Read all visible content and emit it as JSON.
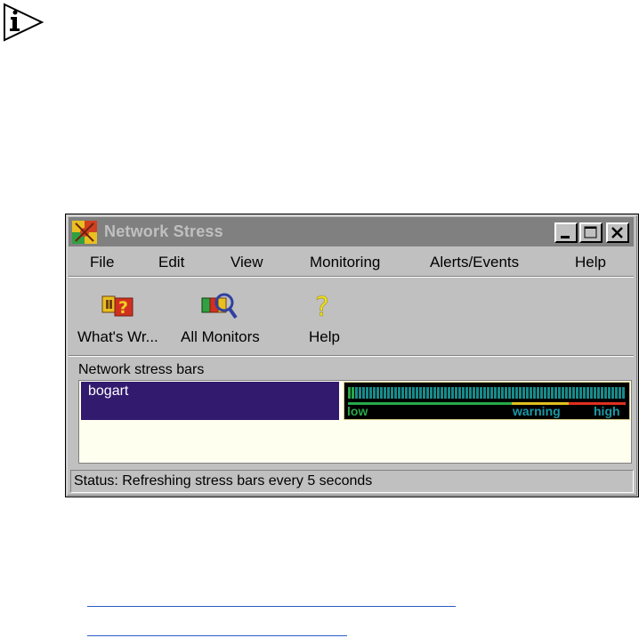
{
  "window": {
    "title": "Network Stress",
    "controls": [
      "minimize",
      "maximize",
      "close"
    ]
  },
  "menu": [
    "File",
    "Edit",
    "View",
    "Monitoring",
    "Alerts/Events",
    "Help"
  ],
  "toolbar": {
    "items": [
      {
        "label": "What's Wr...",
        "icon": "whats-wrong-icon"
      },
      {
        "label": "All Monitors",
        "icon": "all-monitors-icon"
      },
      {
        "label": "Help",
        "icon": "help-question-icon"
      }
    ]
  },
  "section_label": "Network stress bars",
  "hosts": [
    {
      "name": "bogart",
      "stress_level": 0.02,
      "scale_labels": {
        "low": "low",
        "warning": "warning",
        "high": "high"
      }
    }
  ],
  "status": "Status: Refreshing stress bars every 5 seconds",
  "colors": {
    "title_bar": "#808080",
    "host_background": "#321a6e",
    "bar_low": "#27a84a",
    "bar_warning": "#e0c020",
    "bar_high": "#e03020",
    "bar_ticks": "#1a8a8a"
  }
}
